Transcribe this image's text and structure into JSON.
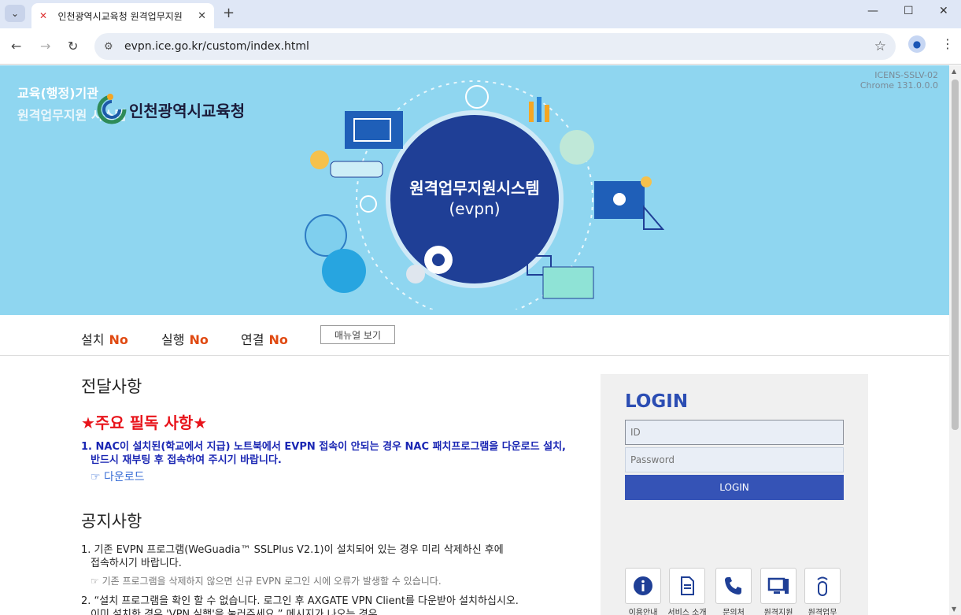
{
  "browser": {
    "tab_title": "인천광역시교육청 원격업무지원",
    "url": "evpn.ice.go.kr/custom/index.html"
  },
  "banner": {
    "sub1": "교육(행정)기관",
    "sub2": "원격업무지원 시스템",
    "org_name": "인천광역시교육청",
    "version_line1": "ICENS-SSLV-02",
    "version_line2": "Chrome 131.0.0.0",
    "circle_title": "원격업무지원시스템",
    "circle_sub": "(evpn)"
  },
  "status": {
    "install_label": "설치",
    "install_value": "No",
    "run_label": "실행",
    "run_value": "No",
    "connect_label": "연결",
    "connect_value": "No",
    "manual_button": "매뉴얼 보기"
  },
  "notices": {
    "delivery_heading": "전달사항",
    "important": "★주요 필독 사항★",
    "nac_line1": "1. NAC이 설치된(학교에서 지급) 노트북에서 EVPN 접속이 안되는 경우 NAC 패치프로그램을 다운로드 설치,",
    "nac_line2": "반드시 재부팅 후 접속하여 주시기 바랍니다.",
    "download": "☞ 다운로드",
    "notice_heading": "공지사항",
    "item1_line1": "1. 기존 EVPN 프로그램(WeGuadia™ SSLPlus V2.1)이 설치되어 있는 경우 미리 삭제하신 후에",
    "item1_line2": "접속하시기 바랍니다.",
    "item1_sub": "☞ 기존 프로그램을 삭제하지 않으면 신규 EVPN 로그인 시에 오류가 발생할 수 있습니다.",
    "item2_line1": "2. “설치 프로그램을 확인 할 수 없습니다. 로그인 후 AXGATE VPN Client를 다운받아 설치하십시오.",
    "item2_line2": "이미 설치한 경우 'VPN 실행'을 눌러주세요.” 메시지가 나오는 경우"
  },
  "login": {
    "title": "LOGIN",
    "id_placeholder": "ID",
    "pw_placeholder": "Password",
    "button": "LOGIN"
  },
  "quick_links": [
    {
      "label": "이용안내",
      "icon": "info-icon"
    },
    {
      "label": "서비스 소개",
      "icon": "document-icon"
    },
    {
      "label": "문의처",
      "icon": "keypad-phone-icon"
    },
    {
      "label": "원격지원",
      "icon": "monitor-icon"
    },
    {
      "label": "원격업무",
      "icon": "usb-key-icon"
    }
  ],
  "colors": {
    "banner_bg": "#8fd6f0",
    "status_no": "#e04a12",
    "login_blue": "#3553b6",
    "important_red": "#e8141b",
    "note_blue": "#1a26b3"
  }
}
